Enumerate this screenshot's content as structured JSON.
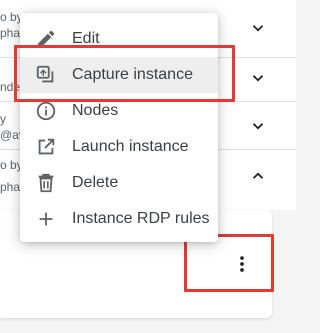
{
  "background_rows": [
    {
      "line1": "o by",
      "line2": "pha"
    },
    {
      "line1": "nde",
      "line2": ""
    },
    {
      "line1": "y",
      "line2": "@av"
    },
    {
      "line1": "o by",
      "line2": "pha"
    }
  ],
  "menu": {
    "items": [
      {
        "label": "Edit",
        "icon": "pencil-icon"
      },
      {
        "label": "Capture instance",
        "icon": "capture-icon"
      },
      {
        "label": "Nodes",
        "icon": "info-icon"
      },
      {
        "label": "Launch instance",
        "icon": "open-external-icon"
      },
      {
        "label": "Delete",
        "icon": "trash-icon"
      },
      {
        "label": "Instance RDP rules",
        "icon": "plus-icon"
      }
    ],
    "hovered_item": "Capture instance"
  },
  "colors": {
    "highlight_border": "#e53935",
    "menu_hover": "#eeeeee",
    "icon": "#5f6368"
  }
}
